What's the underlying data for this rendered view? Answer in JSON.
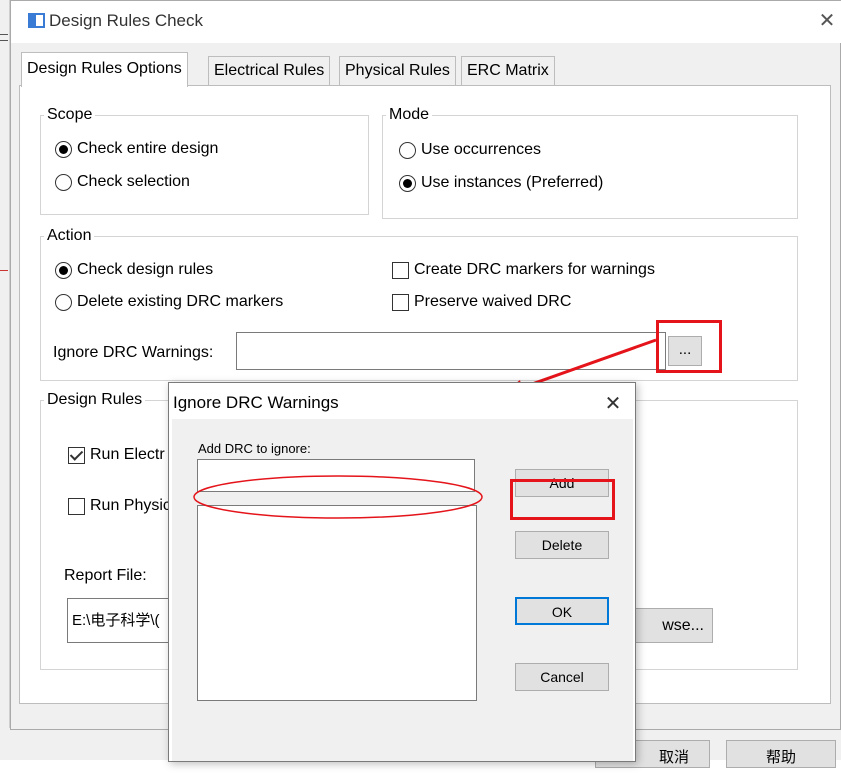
{
  "dialog": {
    "title": "Design Rules Check",
    "close_glyph": "✕",
    "tabs": [
      "Design Rules Options",
      "Electrical Rules",
      "Physical Rules",
      "ERC Matrix"
    ]
  },
  "scope": {
    "title": "Scope",
    "options": [
      {
        "label": "Check entire design",
        "selected": true
      },
      {
        "label": "Check selection",
        "selected": false
      }
    ]
  },
  "mode": {
    "title": "Mode",
    "options": [
      {
        "label": "Use occurrences",
        "selected": false
      },
      {
        "label": "Use instances (Preferred)",
        "selected": true
      }
    ]
  },
  "action": {
    "title": "Action",
    "radios": [
      {
        "label": "Check design rules",
        "selected": true
      },
      {
        "label": "Delete existing DRC markers",
        "selected": false
      }
    ],
    "checks": [
      {
        "label": "Create DRC markers for warnings",
        "checked": false
      },
      {
        "label": "Preserve waived DRC",
        "checked": false
      }
    ],
    "ignore_label": "Ignore DRC Warnings:",
    "ignore_value": "",
    "browse_ellipsis": "..."
  },
  "design_rules": {
    "title": "Design Rules",
    "checks": [
      {
        "label": "Run Electr",
        "checked": true
      },
      {
        "label": "Run Physic",
        "checked": false
      }
    ],
    "report_label": "Report File:",
    "report_path": "E:\\电子科学\\(",
    "browse_label": "wse..."
  },
  "bottom_buttons": {
    "cancel_partial": "取消",
    "help": "帮助"
  },
  "popup": {
    "title": "Ignore DRC Warnings",
    "close_glyph": "✕",
    "add_label_text": "Add DRC to ignore:",
    "add_input_value": "",
    "buttons": {
      "add": "Add",
      "delete": "Delete",
      "ok": "OK",
      "cancel": "Cancel"
    }
  },
  "annotations": {
    "highlight_color": "#e4141a"
  }
}
